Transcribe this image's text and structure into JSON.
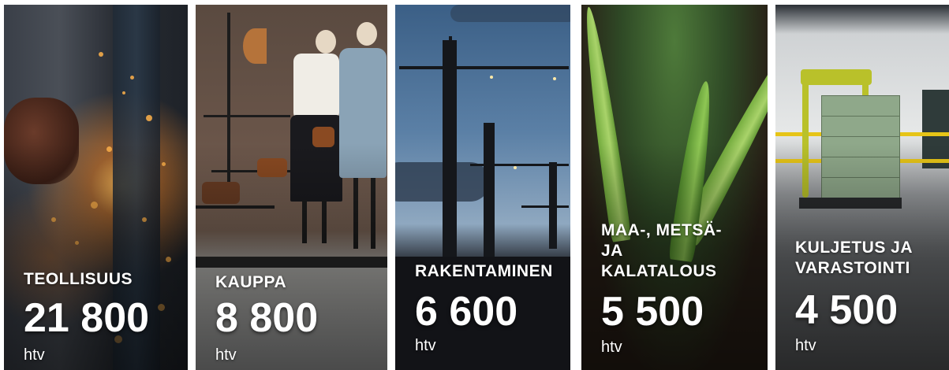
{
  "cards": [
    {
      "label": "TEOLLISUUS",
      "value": "21 800",
      "unit": "htv",
      "image": "welding-sparks-image"
    },
    {
      "label": "KAUPPA",
      "value": "8 800",
      "unit": "htv",
      "image": "shop-window-mannequins-image"
    },
    {
      "label": "RAKENTAMINEN",
      "value": "6 600",
      "unit": "htv",
      "image": "construction-cranes-image"
    },
    {
      "label": "MAA-, METSÄ-\nJA\nKALATALOUS",
      "value": "5 500",
      "unit": "htv",
      "image": "seedling-in-soil-image"
    },
    {
      "label": "KULJETUS JA\nVARASTOINTI",
      "value": "4 500",
      "unit": "htv",
      "image": "warehouse-forklift-image"
    }
  ],
  "colors": {
    "text": "#ffffff",
    "sparks": "#ffb24a",
    "forklift": "#b9c12a",
    "warehouse_rail": "#e6c417",
    "seedling": "#a9d36a"
  }
}
